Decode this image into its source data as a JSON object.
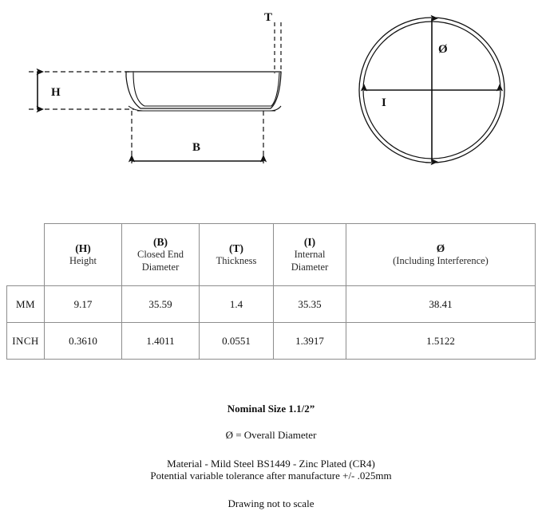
{
  "drawings": {
    "side_view": {
      "name": "end-cap-side-profile",
      "labels": {
        "height": "H",
        "closed_end_diameter": "B",
        "thickness": "T"
      }
    },
    "plan_view": {
      "name": "end-cap-plan-circle",
      "labels": {
        "overall_diameter": "Ø",
        "internal_diameter": "I"
      }
    }
  },
  "table": {
    "columns": [
      {
        "code": "(H)",
        "desc": "Height"
      },
      {
        "code": "(B)",
        "desc": "Closed End\nDiameter"
      },
      {
        "code": "(T)",
        "desc": "Thickness"
      },
      {
        "code": "(I)",
        "desc": "Internal\nDiameter"
      },
      {
        "code": "Ø",
        "desc": "(Including Interference)"
      }
    ],
    "column_codes": {
      "h": "(H)",
      "b": "(B)",
      "t": "(T)",
      "i": "(I)",
      "od": "Ø"
    },
    "column_descs": {
      "h": "Height",
      "b_line1": "Closed End",
      "b_line2": "Diameter",
      "t": "Thickness",
      "i_line1": "Internal",
      "i_line2": "Diameter",
      "od": "(Including Interference)"
    },
    "rows": [
      {
        "unit": "MM",
        "h": "9.17",
        "b": "35.59",
        "t": "1.4",
        "i": "35.35",
        "od": "38.41"
      },
      {
        "unit": "INCH",
        "h": "0.3610",
        "b": "1.4011",
        "t": "0.0551",
        "i": "1.3917",
        "od": "1.5122"
      }
    ]
  },
  "notes": {
    "nominal_size": "Nominal Size 1.1/2”",
    "diameter_key": "Ø = Overall Diameter",
    "material": "Material - Mild Steel BS1449 - Zinc Plated (CR4)",
    "tolerance": "Potential variable tolerance after manufacture +/- .025mm",
    "scale_note": "Drawing not to scale"
  },
  "colors": {
    "line": "#111111",
    "table_border": "#8d8d8d",
    "text": "#111111"
  }
}
